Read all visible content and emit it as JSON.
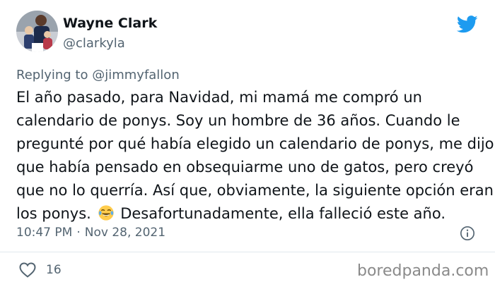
{
  "author": {
    "display_name": "Wayne Clark",
    "handle": "@clarkyla"
  },
  "reply": {
    "prefix": "Replying to",
    "mention": "@jimmyfallon"
  },
  "tweet": {
    "lines": [
      "El año pasado, para Navidad, mi mamá me compró un",
      "calendario de ponys. Soy un hombre de 36 años. Cuando le",
      "pregunté por qué había elegido un calendario de ponys, me dijo",
      "que había pensado en obsequiarme uno de gatos, pero creyó",
      "que no lo querría. Así que, obviamente, la siguiente opción eran"
    ],
    "last_line_before_emoji": "los ponys.",
    "last_line_after_emoji": "Desafortunadamente, ella falleció este año.",
    "emoji": "face-with-tears-of-joy"
  },
  "meta": {
    "time": "10:47 PM",
    "separator": "·",
    "date": "Nov 28, 2021"
  },
  "engagement": {
    "likes": "16"
  },
  "watermark": "boredpanda.com",
  "icons": {
    "brand": "twitter-bird-icon",
    "info": "info-icon",
    "like": "heart-icon"
  },
  "colors": {
    "twitter_blue": "#1d9bf0",
    "secondary_text": "#536471",
    "primary_text": "#0f1419"
  }
}
